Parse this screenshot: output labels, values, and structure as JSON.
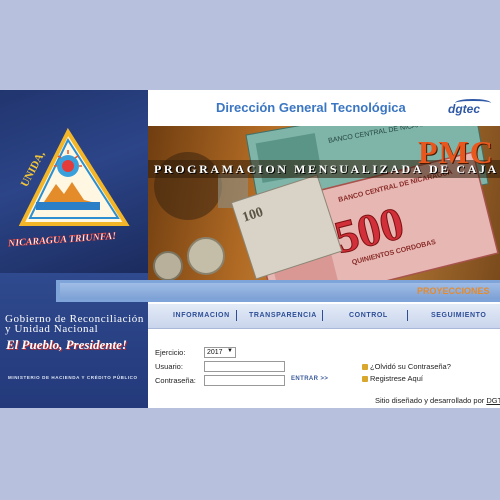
{
  "header": {
    "title": "Dirección General Tecnológica",
    "brand": "dgtec"
  },
  "logo": {
    "arc_text": "UNIDA,",
    "bottom_text": "NICARAGUA TRIUNFA!"
  },
  "sidebar": {
    "government_line1": "Gobierno de Reconciliación",
    "government_line2": "y Unidad Nacional",
    "slogan": "El Pueblo, Presidente!",
    "ministry": "MINISTERIO DE HACIENDA Y CRÉDITO PÚBLICO"
  },
  "banner": {
    "acronym": "PMC",
    "program_title": "PROGRAMACION MENSUALIZADA DE CAJA",
    "banknote_value": "500",
    "banknote_text": "QUINIENTOS CORDOBAS",
    "banknote_bank": "BANCO CENTRAL DE NICARAGUA",
    "banknote_small": "100"
  },
  "projections_label": "PROYECCIONES",
  "nav": {
    "items": [
      "INFORMACION",
      "TRANSPARENCIA",
      "CONTROL",
      "SEGUIMIENTO"
    ]
  },
  "form": {
    "year_label": "Ejercicio:",
    "year_value": "2017",
    "user_label": "Usuario:",
    "password_label": "Contraseña:",
    "submit_label": "ENTRAR >>",
    "user_value": "",
    "password_value": ""
  },
  "links": {
    "forgot": "¿Olvidó su Contraseña?",
    "register": "Registrese Aquí"
  },
  "footer": {
    "text": "Sitio diseñado y desarrollado por ",
    "link": "DGTEC"
  },
  "colors": {
    "accent_blue": "#3b76c2",
    "accent_orange": "#e8571e",
    "sidebar_navy": "#23397a",
    "outer_background": "#b7c1de"
  }
}
